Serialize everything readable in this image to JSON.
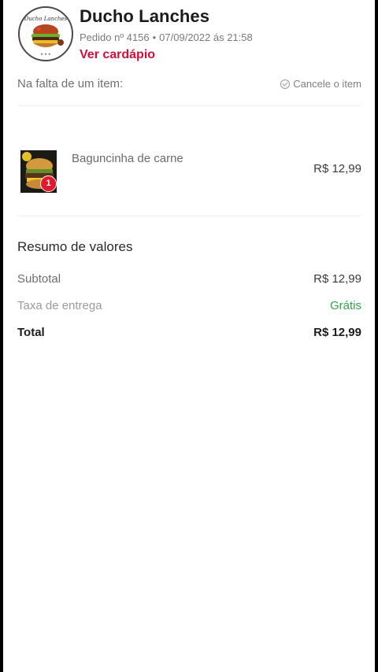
{
  "store": {
    "name": "Ducho Lanches",
    "order_number": "Pedido nº 4156",
    "order_date": "07/09/2022 ás 21:58",
    "menu_link": "Ver cardápio",
    "logo_text": "Ducho Lanches"
  },
  "missing_item": {
    "label": "Na falta de um item:",
    "option": "Cancele o item"
  },
  "items": [
    {
      "name": "Baguncinha de carne",
      "quantity": "1",
      "price": "R$ 12,99"
    }
  ],
  "summary": {
    "title": "Resumo de valores",
    "subtotal_label": "Subtotal",
    "subtotal_value": "R$ 12,99",
    "delivery_label": "Taxa de entrega",
    "delivery_value": "Grátis",
    "total_label": "Total",
    "total_value": "R$ 12,99"
  },
  "colors": {
    "accent": "#d0103a",
    "free_green": "#2fa34a",
    "badge_red": "#e3192f"
  }
}
